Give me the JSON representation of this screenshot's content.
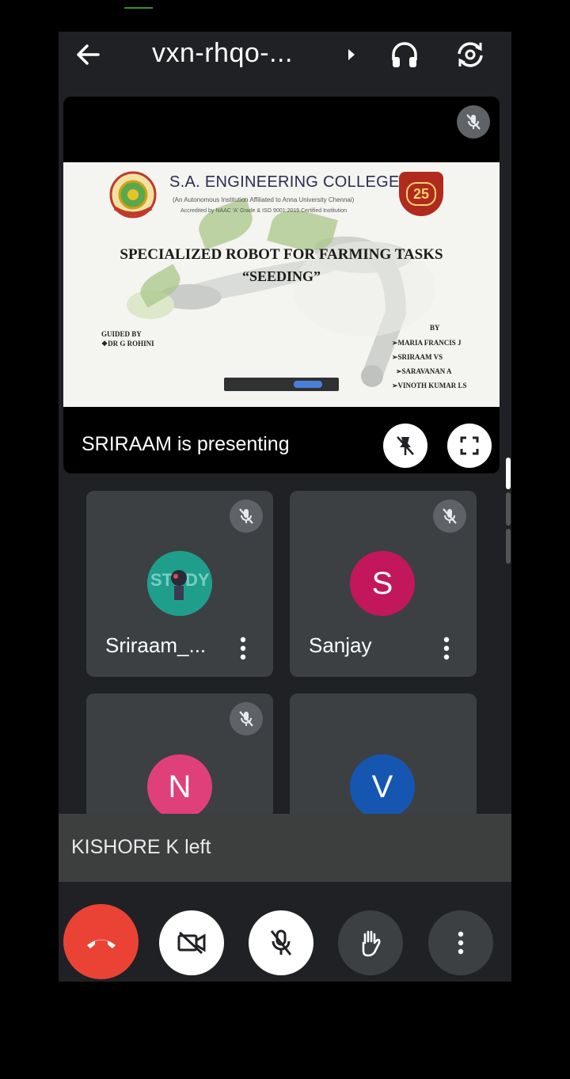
{
  "meeting": {
    "code": "vxn-rhqo-..."
  },
  "presentation": {
    "presenter_label": "SRIRAAM is presenting",
    "slide": {
      "college_name": "S.A. ENGINEERING COLLEGE",
      "college_sub": "(An Autonomous Institution Affiliated to Anna University Chennai)",
      "college_sub2": "Accredited by NAAC 'A' Grade & ISO 9001:2015 Certified Institution",
      "badge_number": "25",
      "title_line1": "SPECIALIZED ROBOT FOR FARMING TASKS",
      "title_line2": "“SEEDING”",
      "guided_label": "GUIDED BY",
      "guide_name": "❖DR G ROHINI",
      "by_label": "BY",
      "authors": [
        "➢MARIA FRANCIS J",
        "➢SRIRAAM VS",
        "➢SARAVANAN A",
        "➢VINOTH KUMAR LS"
      ]
    }
  },
  "participants": [
    {
      "name": "Sriraam_...",
      "initial": "",
      "avatar_color": "#2ab7a0",
      "muted": true
    },
    {
      "name": "Sanjay",
      "initial": "S",
      "avatar_color": "#c2185b",
      "muted": true
    },
    {
      "name": "",
      "initial": "N",
      "avatar_color": "#e0407a",
      "muted": true
    },
    {
      "name": "",
      "initial": "V",
      "avatar_color": "#1557b0",
      "muted": false
    }
  ],
  "toast": {
    "message": "KISHORE K left"
  },
  "colors": {
    "end_call": "#ea4335",
    "background": "#202124",
    "tile": "#3c4043"
  }
}
